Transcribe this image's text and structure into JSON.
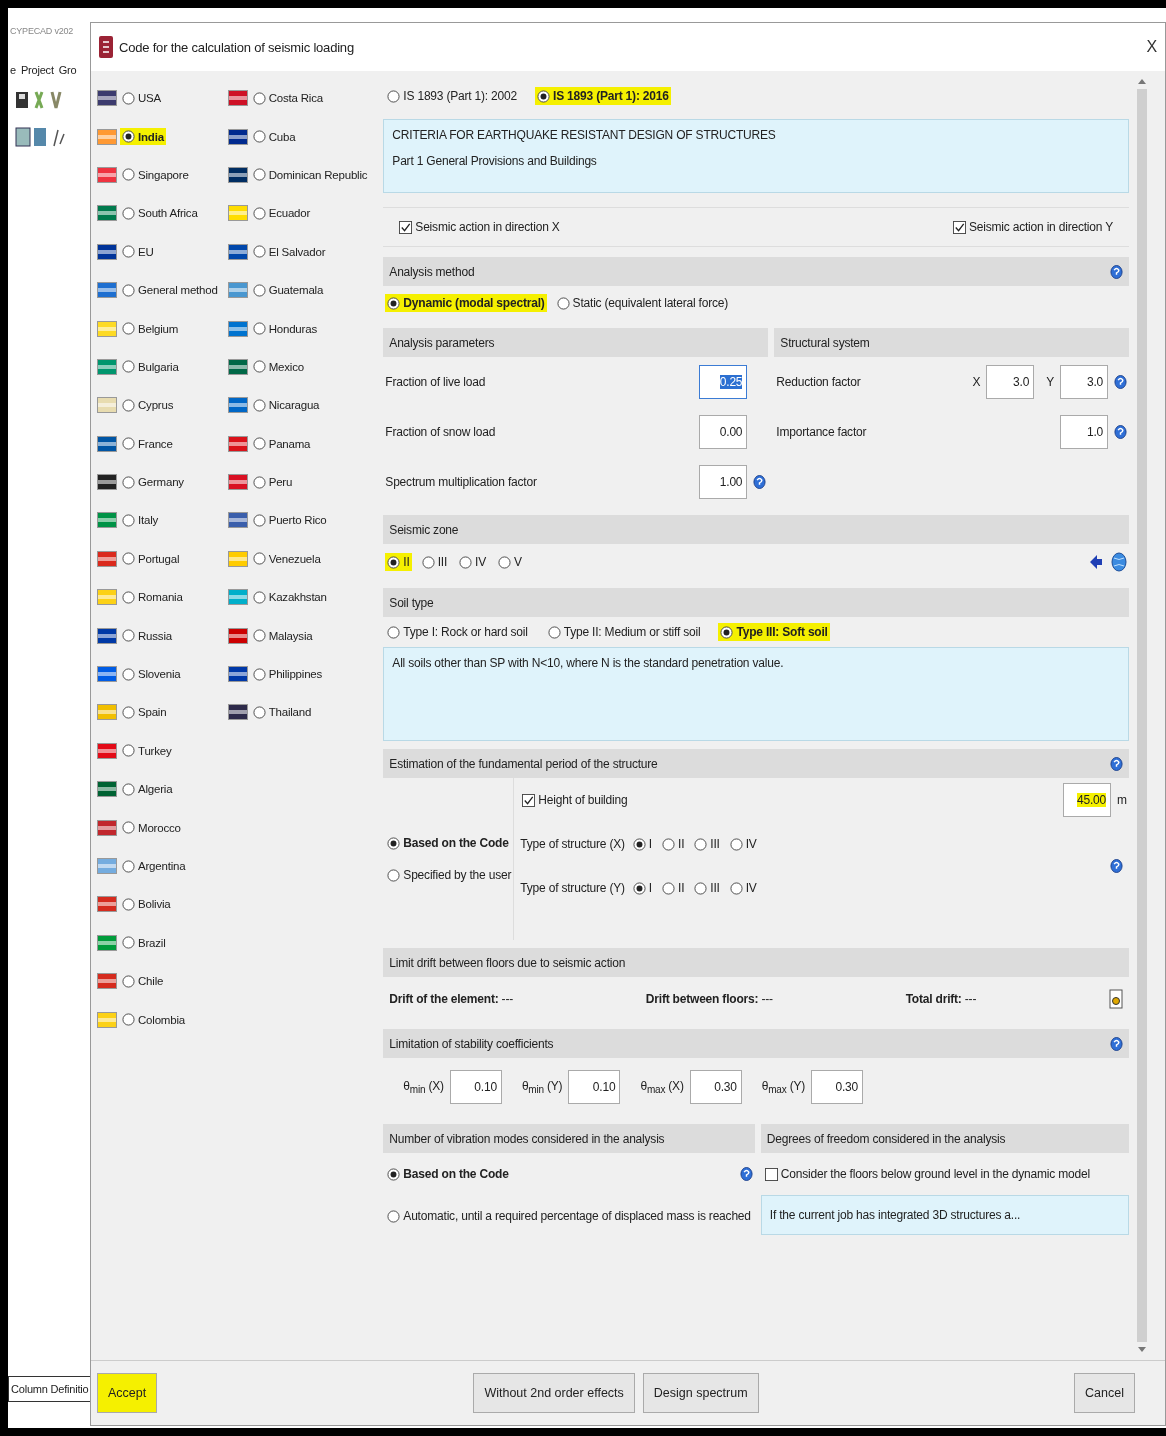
{
  "app": {
    "title": "CYPECAD v202",
    "menu": [
      "e",
      "Project",
      "Gro"
    ],
    "bottom_tab": "Column Definitio"
  },
  "dialog": {
    "title": "Code for the calculation of seismic loading",
    "close": "X"
  },
  "countries": [
    [
      {
        "name": "USA",
        "selected": false,
        "highlighted": false,
        "color": "#3c3b6e"
      },
      {
        "name": "India",
        "selected": true,
        "highlighted": true,
        "color": "#ff9933"
      },
      {
        "name": "Singapore",
        "selected": false,
        "highlighted": false,
        "color": "#ef3340"
      },
      {
        "name": "South Africa",
        "selected": false,
        "highlighted": false,
        "color": "#007a4d"
      },
      {
        "name": "EU",
        "selected": false,
        "highlighted": false,
        "color": "#003399"
      },
      {
        "name": "General method",
        "selected": false,
        "highlighted": false,
        "color": "#1e6fd0"
      },
      {
        "name": "Belgium",
        "selected": false,
        "highlighted": false,
        "color": "#fdda24"
      },
      {
        "name": "Bulgaria",
        "selected": false,
        "highlighted": false,
        "color": "#00966e"
      },
      {
        "name": "Cyprus",
        "selected": false,
        "highlighted": false,
        "color": "#e8dcb0"
      },
      {
        "name": "France",
        "selected": false,
        "highlighted": false,
        "color": "#0055a4"
      },
      {
        "name": "Germany",
        "selected": false,
        "highlighted": false,
        "color": "#222222"
      },
      {
        "name": "Italy",
        "selected": false,
        "highlighted": false,
        "color": "#009246"
      },
      {
        "name": "Portugal",
        "selected": false,
        "highlighted": false,
        "color": "#da291c"
      },
      {
        "name": "Romania",
        "selected": false,
        "highlighted": false,
        "color": "#fcd116"
      },
      {
        "name": "Russia",
        "selected": false,
        "highlighted": false,
        "color": "#0039a6"
      },
      {
        "name": "Slovenia",
        "selected": false,
        "highlighted": false,
        "color": "#005ce5"
      },
      {
        "name": "Spain",
        "selected": false,
        "highlighted": false,
        "color": "#f1bf00"
      },
      {
        "name": "Turkey",
        "selected": false,
        "highlighted": false,
        "color": "#e30a17"
      },
      {
        "name": "Algeria",
        "selected": false,
        "highlighted": false,
        "color": "#006233"
      },
      {
        "name": "Morocco",
        "selected": false,
        "highlighted": false,
        "color": "#c1272d"
      },
      {
        "name": "Argentina",
        "selected": false,
        "highlighted": false,
        "color": "#74acdf"
      },
      {
        "name": "Bolivia",
        "selected": false,
        "highlighted": false,
        "color": "#d52b1e"
      },
      {
        "name": "Brazil",
        "selected": false,
        "highlighted": false,
        "color": "#009c3b"
      },
      {
        "name": "Chile",
        "selected": false,
        "highlighted": false,
        "color": "#d52b1e"
      },
      {
        "name": "Colombia",
        "selected": false,
        "highlighted": false,
        "color": "#fcd116"
      }
    ],
    [
      {
        "name": "Costa Rica",
        "selected": false,
        "highlighted": false,
        "color": "#ce1126"
      },
      {
        "name": "Cuba",
        "selected": false,
        "highlighted": false,
        "color": "#002a8f"
      },
      {
        "name": "Dominican Republic",
        "selected": false,
        "highlighted": false,
        "color": "#002d62"
      },
      {
        "name": "Ecuador",
        "selected": false,
        "highlighted": false,
        "color": "#ffdd00"
      },
      {
        "name": "El Salvador",
        "selected": false,
        "highlighted": false,
        "color": "#0047ab"
      },
      {
        "name": "Guatemala",
        "selected": false,
        "highlighted": false,
        "color": "#4997d0"
      },
      {
        "name": "Honduras",
        "selected": false,
        "highlighted": false,
        "color": "#0073cf"
      },
      {
        "name": "Mexico",
        "selected": false,
        "highlighted": false,
        "color": "#006847"
      },
      {
        "name": "Nicaragua",
        "selected": false,
        "highlighted": false,
        "color": "#0067c6"
      },
      {
        "name": "Panama",
        "selected": false,
        "highlighted": false,
        "color": "#da121a"
      },
      {
        "name": "Peru",
        "selected": false,
        "highlighted": false,
        "color": "#d91023"
      },
      {
        "name": "Puerto Rico",
        "selected": false,
        "highlighted": false,
        "color": "#3a5eab"
      },
      {
        "name": "Venezuela",
        "selected": false,
        "highlighted": false,
        "color": "#ffcc00"
      },
      {
        "name": "Kazakhstan",
        "selected": false,
        "highlighted": false,
        "color": "#00afca"
      },
      {
        "name": "Malaysia",
        "selected": false,
        "highlighted": false,
        "color": "#cc0001"
      },
      {
        "name": "Philippines",
        "selected": false,
        "highlighted": false,
        "color": "#0038a8"
      },
      {
        "name": "Thailand",
        "selected": false,
        "highlighted": false,
        "color": "#2d2a4a"
      }
    ]
  ],
  "code_versions": [
    {
      "label": "IS 1893 (Part 1): 2002",
      "selected": false,
      "highlighted": false
    },
    {
      "label": "IS 1893 (Part 1): 2016",
      "selected": true,
      "highlighted": true
    }
  ],
  "description": [
    "CRITERIA FOR EARTHQUAKE RESISTANT DESIGN OF STRUCTURES",
    "Part 1 General Provisions and Buildings"
  ],
  "directions": [
    {
      "label": "Seismic action in direction X",
      "checked": true
    },
    {
      "label": "Seismic action in direction Y",
      "checked": true
    }
  ],
  "analysis_method": {
    "title": "Analysis method",
    "options": [
      {
        "label": "Dynamic (modal spectral)",
        "selected": true,
        "highlighted": true
      },
      {
        "label": "Static (equivalent lateral force)",
        "selected": false,
        "highlighted": false
      }
    ]
  },
  "analysis_parameters": {
    "title": "Analysis parameters",
    "rows": [
      {
        "label": "Fraction of live load",
        "value": "0.25",
        "text_selected": true,
        "help": false
      },
      {
        "label": "Fraction of snow load",
        "value": "0.00",
        "text_selected": false,
        "help": false
      },
      {
        "label": "Spectrum multiplication factor",
        "value": "1.00",
        "text_selected": false,
        "help": true
      }
    ]
  },
  "structural_system": {
    "title": "Structural system",
    "rows": [
      {
        "label": "Reduction factor",
        "fields": [
          {
            "axis": "X",
            "value": "3.0"
          },
          {
            "axis": "Y",
            "value": "3.0"
          }
        ]
      },
      {
        "label": "Importance factor",
        "fields": [
          {
            "value": "1.0"
          }
        ]
      }
    ]
  },
  "seismic_zone": {
    "title": "Seismic zone",
    "options": [
      {
        "label": "II",
        "selected": true,
        "highlighted": true
      },
      {
        "label": "III",
        "selected": false,
        "highlighted": false
      },
      {
        "label": "IV",
        "selected": false,
        "highlighted": false
      },
      {
        "label": "V",
        "selected": false,
        "highlighted": false
      }
    ]
  },
  "soil_type": {
    "title": "Soil type",
    "options": [
      {
        "label": "Type I: Rock or hard soil",
        "selected": false,
        "highlighted": false
      },
      {
        "label": "Type II: Medium or stiff soil",
        "selected": false,
        "highlighted": false
      },
      {
        "label": "Type III: Soft soil",
        "selected": true,
        "highlighted": true
      }
    ],
    "description": "All soils other than SP with N<10, where N is the standard penetration value."
  },
  "period": {
    "title": "Estimation of the fundamental period of the structure",
    "methods": [
      {
        "label": "Based on the Code",
        "selected": true
      },
      {
        "label": "Specified by the user",
        "selected": false
      }
    ],
    "height": {
      "label": "Height of building",
      "checked": true,
      "value": "45.00",
      "unit": "m",
      "highlighted": true
    },
    "structure_types": [
      {
        "label": "Type of structure (X)",
        "options": [
          {
            "label": "I",
            "selected": true
          },
          {
            "label": "II",
            "selected": false
          },
          {
            "label": "III",
            "selected": false
          },
          {
            "label": "IV",
            "selected": false
          }
        ]
      },
      {
        "label": "Type of structure (Y)",
        "options": [
          {
            "label": "I",
            "selected": true
          },
          {
            "label": "II",
            "selected": false
          },
          {
            "label": "III",
            "selected": false
          },
          {
            "label": "IV",
            "selected": false
          }
        ]
      }
    ]
  },
  "drift": {
    "title": "Limit drift between floors due to seismic action",
    "items": [
      {
        "label": "Drift of the element:",
        "value": "---"
      },
      {
        "label": "Drift between floors:",
        "value": "---"
      },
      {
        "label": "Total drift:",
        "value": "---"
      }
    ]
  },
  "stability": {
    "title": "Limitation of stability coefficients",
    "fields": [
      {
        "label": "θ$_{min}$ (X)",
        "value": "0.10"
      },
      {
        "label": "θ$_{min}$ (Y)",
        "value": "0.10"
      },
      {
        "label": "θ$_{max}$ (X)",
        "value": "0.30"
      },
      {
        "label": "θ$_{max}$ (Y)",
        "value": "0.30"
      }
    ]
  },
  "modes": {
    "title": "Number of vibration modes considered in the analysis",
    "options": [
      {
        "label": "Based on the Code",
        "selected": true
      },
      {
        "label": "Automatic, until a required percentage of displaced mass is reached",
        "selected": false
      }
    ]
  },
  "freedom": {
    "title": "Degrees of freedom considered in the analysis",
    "checkbox": {
      "label": "Consider the floors below ground level in the dynamic model",
      "checked": false
    },
    "note": "If the current job has integrated 3D structures a..."
  },
  "footer": {
    "left": [
      {
        "label": "Accept",
        "highlighted": true
      }
    ],
    "center": [
      {
        "label": "Without 2nd order effects",
        "highlighted": false
      },
      {
        "label": "Design spectrum",
        "highlighted": false
      }
    ],
    "right": [
      {
        "label": "Cancel",
        "highlighted": false
      }
    ]
  }
}
